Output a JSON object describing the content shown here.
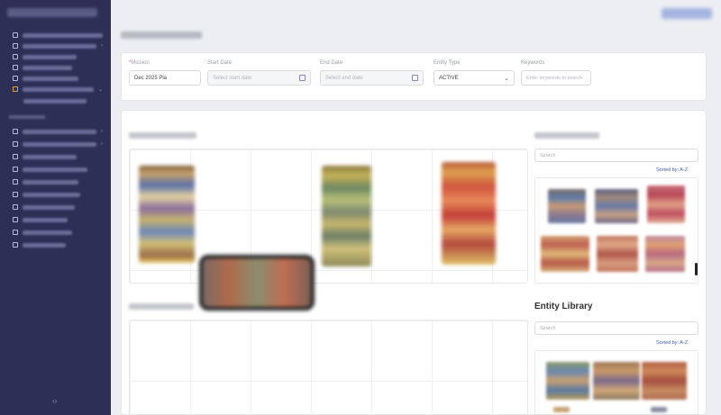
{
  "sidebar": {
    "group1_label": "",
    "group2_label": "",
    "footer_icon": "collapse-icon"
  },
  "filters": {
    "mission": {
      "label": "Mission",
      "value": "Dec 2025 Pla"
    },
    "start_date": {
      "label": "Start Date",
      "placeholder": "Select start date"
    },
    "end_date": {
      "label": "End Date",
      "placeholder": "Select end date"
    },
    "entity_type": {
      "label": "Entity Type",
      "value": "ACTIVE"
    },
    "keywords": {
      "label": "Keywords",
      "placeholder": "Enter keywords to search"
    }
  },
  "library": {
    "title": "Entity Library",
    "search_placeholder": "Search",
    "sort_label": "Sorted by: A-Z"
  },
  "colors": {
    "sidebar_bg": "#2e2f57",
    "accent": "#3a5cc8",
    "page_bg": "#eceef2"
  }
}
